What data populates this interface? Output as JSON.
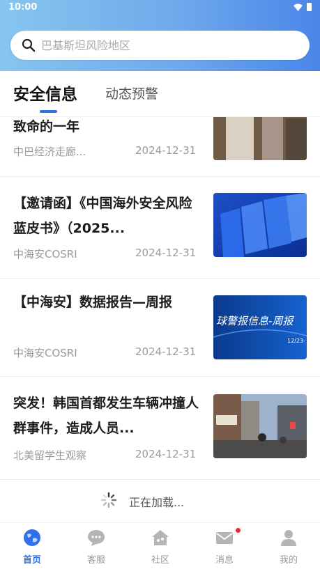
{
  "status_bar": {
    "time": "10:00"
  },
  "search": {
    "placeholder": "巴基斯坦风险地区"
  },
  "tabs": [
    {
      "label": "安全信息",
      "active": true
    },
    {
      "label": "动态预警",
      "active": false
    }
  ],
  "news": [
    {
      "title": "致命的一年",
      "source": "中巴经济走廊...",
      "date": "2024-12-31",
      "thumb": "photo-crowd-icon"
    },
    {
      "title": "【邀请函】《中国海外安全风险蓝皮书》（2025...",
      "source": "中海安COSRI",
      "date": "2024-12-31",
      "thumb": "blue-books-icon"
    },
    {
      "title": "【中海安】数据报告—周报",
      "source": "中海安COSRI",
      "date": "2024-12-31",
      "thumb": "report-banner-icon",
      "thumb_text": "球警报信息-周报",
      "thumb_subtext": "12/23-"
    },
    {
      "title": "突发！韩国首都发生车辆冲撞人群事件，造成人员...",
      "source": "北美留学生观察",
      "date": "2024-12-31",
      "thumb": "street-photo-icon"
    }
  ],
  "loading": {
    "text": "正在加载..."
  },
  "bottom_nav": [
    {
      "label": "首页",
      "icon": "globe-icon",
      "active": true
    },
    {
      "label": "客服",
      "icon": "chat-icon",
      "active": false
    },
    {
      "label": "社区",
      "icon": "community-icon",
      "active": false
    },
    {
      "label": "消息",
      "icon": "mail-icon",
      "active": false,
      "badge": true
    },
    {
      "label": "我的",
      "icon": "user-icon",
      "active": false
    }
  ],
  "colors": {
    "accent": "#2f6fe8",
    "badge": "#e8282e",
    "header_start": "#86c6ee",
    "header_end": "#4a86e8"
  }
}
